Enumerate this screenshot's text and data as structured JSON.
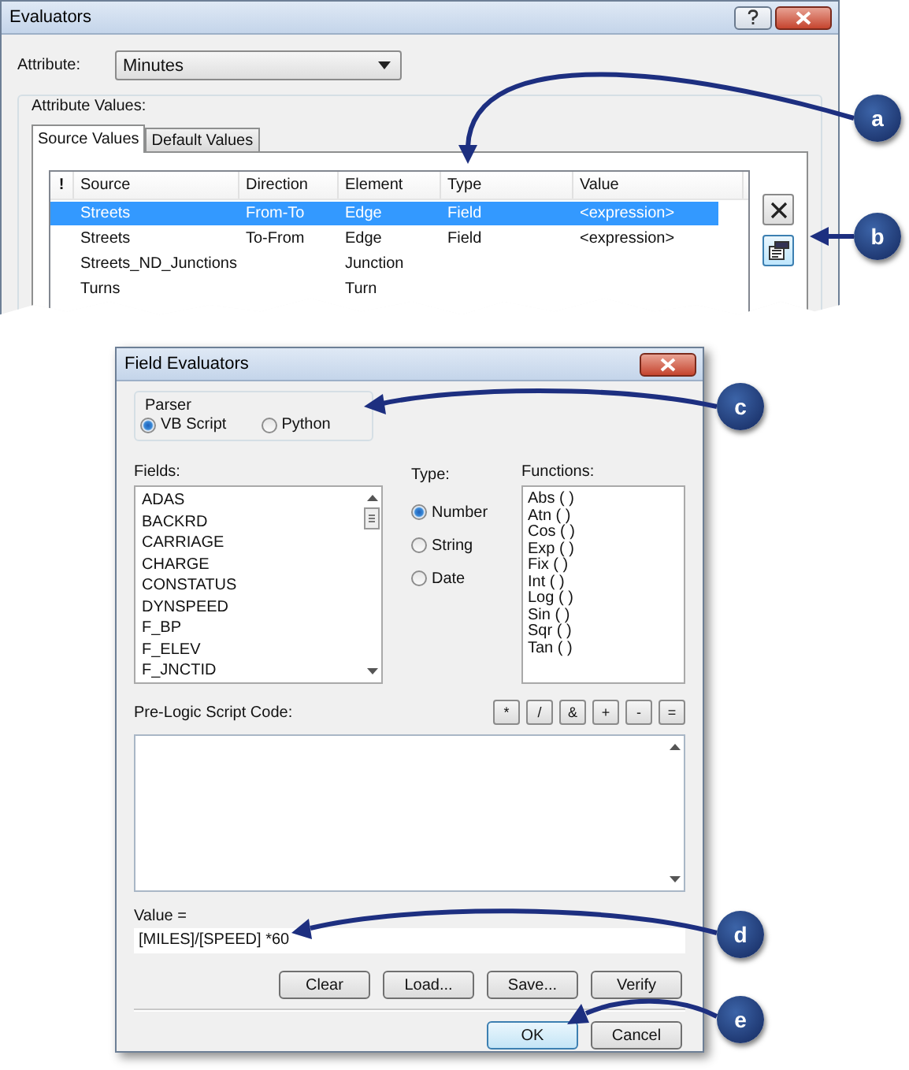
{
  "evaluators_window": {
    "title": "Evaluators",
    "attribute_label": "Attribute:",
    "attribute_value": "Minutes",
    "group_label": "Attribute Values:",
    "tabs": [
      {
        "label": "Source Values",
        "selected": true
      },
      {
        "label": "Default Values",
        "selected": false
      }
    ],
    "table": {
      "columns": [
        "!",
        "Source",
        "Direction",
        "Element",
        "Type",
        "Value"
      ],
      "rows": [
        {
          "source": "Streets",
          "direction": "From-To",
          "element": "Edge",
          "type": "Field",
          "value": "<expression>",
          "selected": true
        },
        {
          "source": "Streets",
          "direction": "To-From",
          "element": "Edge",
          "type": "Field",
          "value": "<expression>",
          "selected": false
        },
        {
          "source": "Streets_ND_Junctions",
          "element": "Junction",
          "selected": false
        },
        {
          "source": "Turns",
          "element": "Turn",
          "selected": false
        }
      ]
    }
  },
  "field_evaluators_window": {
    "title": "Field Evaluators",
    "parser_label": "Parser",
    "parsers": [
      {
        "label": "VB Script",
        "selected": true
      },
      {
        "label": "Python",
        "selected": false
      }
    ],
    "fields_label": "Fields:",
    "fields": [
      "ADAS",
      "BACKRD",
      "CARRIAGE",
      "CHARGE",
      "CONSTATUS",
      "DYNSPEED",
      "F_BP",
      "F_ELEV",
      "F_JNCTID"
    ],
    "type_label": "Type:",
    "types": [
      {
        "label": "Number",
        "selected": true
      },
      {
        "label": "String",
        "selected": false
      },
      {
        "label": "Date",
        "selected": false
      }
    ],
    "functions_label": "Functions:",
    "functions": [
      "Abs ( )",
      "Atn ( )",
      "Cos ( )",
      "Exp ( )",
      "Fix ( )",
      "Int ( )",
      "Log ( )",
      "Sin ( )",
      "Sqr ( )",
      "Tan ( )"
    ],
    "pre_logic_label": "Pre-Logic Script Code:",
    "operators": [
      "*",
      "/",
      "&",
      "+",
      "-",
      "="
    ],
    "value_label": "Value =",
    "value": "[MILES]/[SPEED] *60",
    "tool_buttons": [
      "Clear",
      "Load...",
      "Save...",
      "Verify"
    ],
    "ok_button": "OK",
    "cancel_button": "Cancel"
  },
  "callouts": [
    {
      "label": "a"
    },
    {
      "label": "b"
    },
    {
      "label": "c"
    },
    {
      "label": "d"
    },
    {
      "label": "e"
    }
  ]
}
